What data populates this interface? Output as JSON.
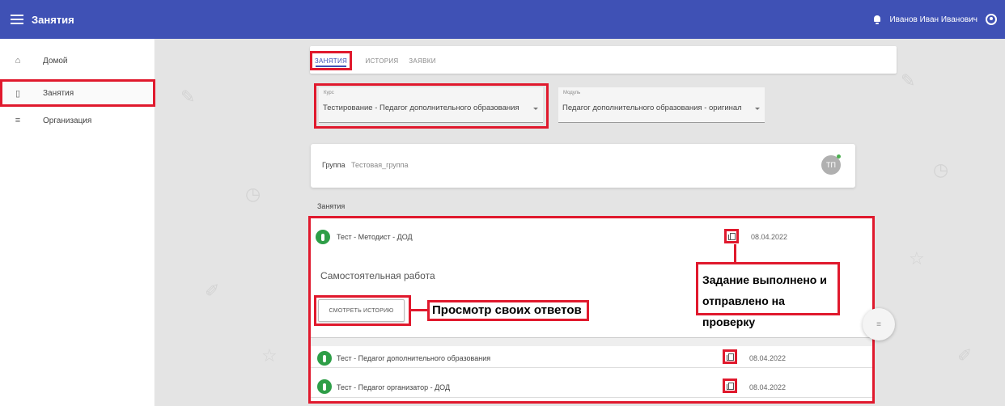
{
  "header": {
    "app_title": "Занятия",
    "user_name": "Иванов Иван Иванович"
  },
  "sidebar": {
    "items": [
      {
        "label": "Домой",
        "icon": "home-icon"
      },
      {
        "label": "Занятия",
        "icon": "book-icon",
        "active": true
      },
      {
        "label": "Организация",
        "icon": "list-icon"
      }
    ]
  },
  "tabs": [
    {
      "label": "ЗАНЯТИЯ",
      "active": true
    },
    {
      "label": "ИСТОРИЯ"
    },
    {
      "label": "ЗАЯВКИ"
    }
  ],
  "filters": {
    "course_label": "Курс",
    "course_value": "Тестирование - Педагог дополнительного образования",
    "module_label": "Модуль",
    "module_value": "Педагог дополнительного образования - оригинал"
  },
  "group": {
    "label": "Группа",
    "value": "Тестовая_группа",
    "avatar_initials": "ТП"
  },
  "lessons_heading": "Занятия",
  "lessons": [
    {
      "title": "Тест - Методист - ДОД",
      "date": "08.04.2022"
    },
    {
      "title": "Тест - Педагог дополнительного образования",
      "date": "08.04.2022"
    },
    {
      "title": "Тест - Педагог организатор - ДОД",
      "date": "08.04.2022"
    }
  ],
  "expanded": {
    "subtitle": "Самостоятельная работа",
    "history_button": "СМОТРЕТЬ ИСТОРИЮ"
  },
  "callouts": {
    "view_answers": "Просмотр своих ответов",
    "task_done_line1": "Задание выполнено и",
    "task_done_line2": "отправлено на проверку"
  },
  "colors": {
    "primary": "#3f51b5",
    "annotation_red": "#e0192d",
    "status_green": "#2e9e47"
  }
}
